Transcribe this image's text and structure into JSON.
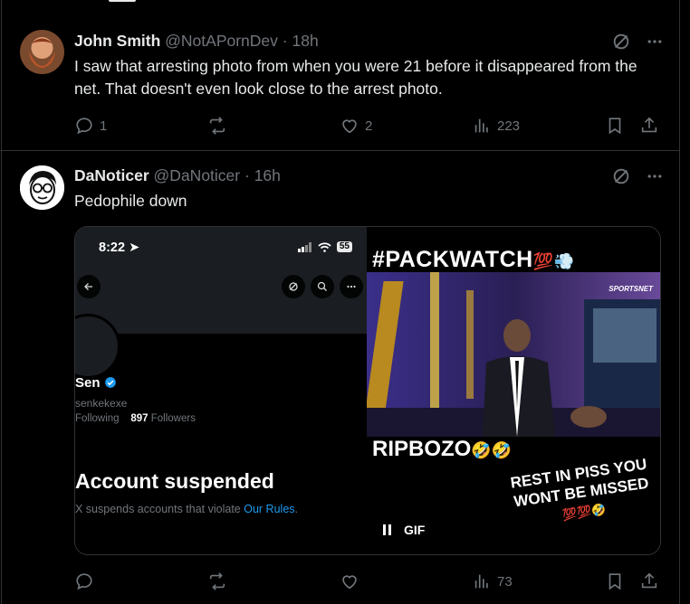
{
  "tweets": [
    {
      "name": "John Smith",
      "handle": "@NotAPornDev",
      "dot": "·",
      "time": "18h",
      "text": "I saw that arresting photo from when you were 21 before it disappeared from the net. That doesn't even look close to the arrest photo.",
      "replies": "1",
      "reposts": "",
      "likes": "2",
      "views": "223"
    },
    {
      "name": "DaNoticer",
      "handle": "@DaNoticer",
      "dot": "·",
      "time": "16h",
      "text": "Pedophile down",
      "replies": "",
      "reposts": "",
      "likes": "",
      "views": "73"
    }
  ],
  "media": {
    "screenshot": {
      "clock": "8:22",
      "battery": "55",
      "profile_name": "Sen",
      "profile_handle": "senkekexe",
      "following_label": "Following",
      "followers_count": "897",
      "followers_label": "Followers",
      "suspended_title": "Account suspended",
      "suspended_text": "X suspends accounts that violate",
      "rules_link": "Our Rules",
      "period": "."
    },
    "gif": {
      "top_caption": "#PACKWATCH",
      "top_emoji": "💯💨",
      "logo": "SPORTSNET",
      "mid_caption": "RIPBOZO",
      "mid_emoji": "🤣🤣",
      "rest_caption": "REST IN PISS YOU WONT BE MISSED",
      "rest_emoji": "💯💯🤣",
      "gif_label": "GIF"
    }
  },
  "icons": [
    "grok-icon",
    "more-icon",
    "reply-icon",
    "repost-icon",
    "like-icon",
    "views-icon",
    "bookmark-icon",
    "share-icon",
    "back-icon",
    "search-icon",
    "verified-icon",
    "pause-icon"
  ],
  "colors": {
    "background": "#000000",
    "text": "#e7e9ea",
    "muted": "#71767b",
    "link": "#1d9bf0",
    "border": "#2f3336"
  }
}
